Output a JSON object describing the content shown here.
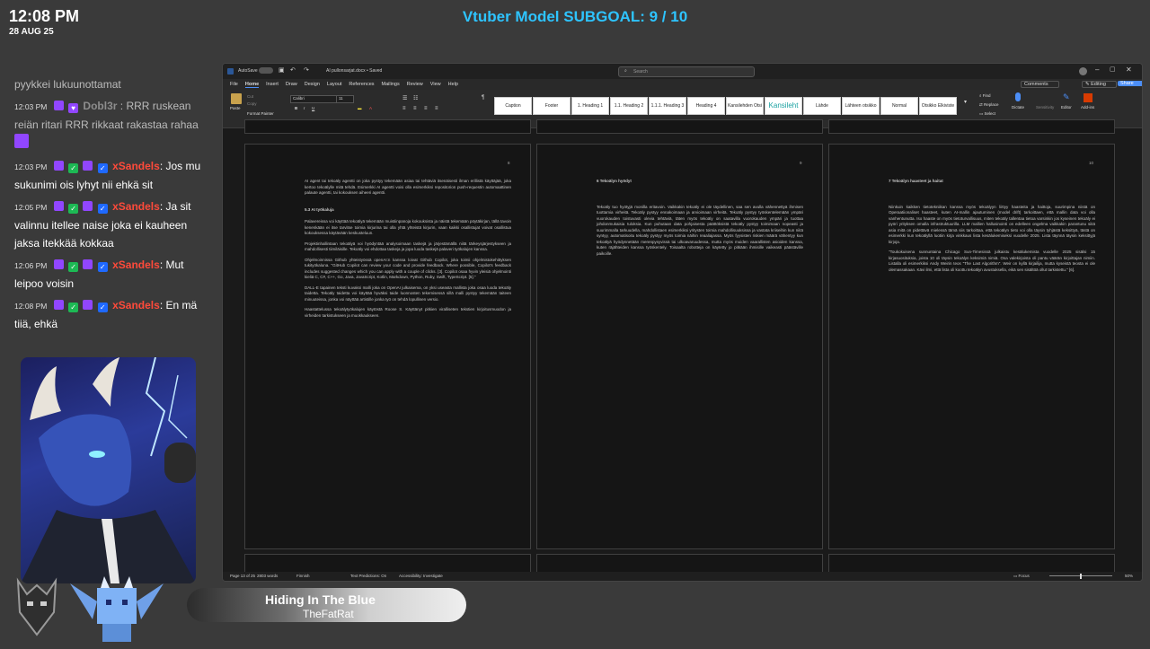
{
  "overlay": {
    "time": "12:08 PM",
    "date": "28 AUG 25",
    "subgoal": "Vtuber Model SUBGOAL: 9 / 10"
  },
  "chat": [
    {
      "time": "",
      "user": "",
      "text": "pyykkei lukuunottamat"
    },
    {
      "time": "12:03 PM",
      "user": "Dobl3r",
      "text": ": RRR ruskean reiän ritari RRR rikkaat rakastaa rahaa"
    },
    {
      "time": "12:03 PM",
      "user": "xSandels",
      "text": ": Jos mu sukunimi ois lyhyt nii ehkä sit"
    },
    {
      "time": "12:05 PM",
      "user": "xSandels",
      "text": ": Ja sit valinnu itellee naise joka ei kauheen jaksa itekkää kokkaa"
    },
    {
      "time": "12:06 PM",
      "user": "xSandels",
      "text": ": Mut leipoo voisin"
    },
    {
      "time": "12:08 PM",
      "user": "xSandels",
      "text": ": En mä tiiä, ehkä"
    }
  ],
  "music": {
    "title": "Hiding In The Blue",
    "artist": "TheFatRat"
  },
  "word": {
    "autosave": "AutoSave",
    "doc_title": "AI pullonsarjat.docx • Saved",
    "search_placeholder": "Search",
    "menu": [
      "File",
      "Home",
      "Insert",
      "Draw",
      "Design",
      "Layout",
      "References",
      "Mailings",
      "Review",
      "View",
      "Help"
    ],
    "comments": "Comments",
    "editing": "Editing",
    "share": "Share",
    "paste": "Paste",
    "cut": "Cut",
    "copy": "Copy",
    "format_painter": "Format Painter",
    "font": "Calibri",
    "font_size": "11",
    "group_clipboard": "Clipboard",
    "group_font": "Font",
    "group_paragraph": "Paragraph",
    "group_styles": "Styles",
    "group_editing": "Editing",
    "group_voice": "Voice",
    "group_sensitivity": "Sensitivity",
    "group_editor": "Editor",
    "group_addins": "Add-ins",
    "styles": [
      "Caption",
      "Footer",
      "1. Heading 1",
      "1.1. Heading 2",
      "1.1.1. Heading 3",
      "Heading 4",
      "Kansilehden Otsi",
      "Kansileht",
      "Lähde",
      "Lähteen otsikko",
      "Normal",
      "Otsikko Elkiviste"
    ],
    "find": "Find",
    "replace": "Replace",
    "select": "Select",
    "dictate": "Dictate",
    "sensitivity": "Sensitivity",
    "editor": "Editor",
    "addins": "Add-ins",
    "status": {
      "page": "Page 13 of 25",
      "words": "2803 words",
      "lang": "Finnish",
      "predictions": "Text Predictions: On",
      "accessibility": "Accessibility: Investigate",
      "focus": "Focus",
      "zoom": "50%"
    },
    "pages": [
      {
        "num": "8",
        "paragraphs": [
          "AI agent tai tekoäly agentti on joka pystyy tekemään asiaa tai tehtäviä itsenäisesti ilman erillistä käyttäjää, joka kertoo tekoälylle mitä tehdä. Esimerkki AI agentti voisi olla esimerkiksi repositorion push-requestin automaattinen palaute agentti, tai kokouksen aiheeri agentti.",
          "5.3      AI työkaluja",
          "Palavereissa voi käyttää tekoälyä tekemään muistiinpanoja kokouksista ja näistä tekemään pöytäkirjan, tällä tavoin kenenkään ei itse tarvitse toimia kirjurina tai olla yhtä yhteistä kirjurin, vaan kaikki osallistujat voivat osallistua kokouksessa käytävään keskusteluun.",
          "Projektinhallintaan tekoälyä voi hyödyntää analysoimaan taskejä ja järjestämällä niitä tärkeysjärjestykseen ja mahdollisesti tiimiläisille. Tekoäly voi ehdottaa taskeja ja jopa luoda taskejä palaveri työkalujen kanssa.",
          "Ohjelmoinnissa Github yhteistyössä openAI:n kanssa loivat Github Copilot, joka toimii ohjelmistokehittyksen tukityökaluna. \"GitHub Copilot can review your code and provide feedback. Where possible, Copilot's feedback includes suggested changes which you can apply with a couple of clicks. [3]. Copilot osaa hyvin yleisiä ohjelmointi kieliä C, C#, C++, Go, Java, JavaScript, Kotlin, Markdown, Python, Ruby, Swift, TypeScript. [5].\"",
          "DALL-E tapainen teksti kuvaksi malli joka on OpenAI julkaisema, on yksi useasta mallista joka osaa luoda tekoäly taidetta. Tekoäly taidetta voi käyttää hyväksi taide luonnosten tekemisessä sillä malli pystyy tekemään taiteen minuuteissa, jonka voi näyttää artistille jonka työ on tehdä lopullinen versio.",
          "Haastattelussa tekoälytyökalujen käytöstä Roose S. Käyttänyt pitkien viralliseten tekstien kirjoitusmuodon ja virheiden tarkistukseen ja muokkaukseen."
        ]
      },
      {
        "num": "9",
        "paragraphs": [
          "6       Tekoälyn hyödyt",
          "Tekoäly tuo hyötyjä monilla eritavoin. Vaikkakin tekoäly ei ole täydellinen, saa sen avulla vähennettyä ihmisen tuottamia virheitä. Tekoäly pystyy ennakoimaan ja arvioimaan virheitä. Tekoäly pystyy työskentelemään ympäri vuorokauden toistuvasti olevia tehtäviä, täten myös tekoäly on saatavilla vuorokauden ympäri ja tuottaa johdonmukaisia tuloksia. Kun puhutaan data pohjaisesta päättöksistä tekoäly pystyy toimimaan nopeasti ja suurimmalla tarkuudella, mahdollistaen esimerkiksi yritysten toimia mahdollisuuksissa ja vastata kriiseihin kun niitä syntyy, automatisoitu tekoäly pystyy myös toimia näihin reaaliajassa. Myös fyysisten riskien määrä vähentyy kun tekoälyä hyödynnetään merenpysyvissä tai ulkoavaruudessa, mutta myös muiden vaarallisten asioiden kanssa, kuten räjähteiden kanssa työskentely. Toisaalta robotteja on käytetty jo pitkään ihmisille vaikeasti päästäville paikoille."
        ]
      },
      {
        "num": "10",
        "paragraphs": [
          "7       Tekoälyn haasteet ja haitat",
          "Niinkuin kaikken tietotekniikan kanssa myös tekoälyyn liittyy haasteita ja haittoja, suurimpina niistä on Operaatiionaliset haasteet, kuten AI-mallin ajautuminen (model drift) tarkoittaen, että mallin data voi olla vanhentunutta. Iso haaste on myös tietoturvallisuus, miten tekoäly tallentaa tietoa varsinkin jos kyseinen tekoäly ei pyöri yrityksen omalla infrastruktuurilla. LLM mallien hallusinointi on edelleen ongelma vaikkakin parantunu siitä asia mitä on pidettävä mielessä tämä siis tarkoittaa, että tekoälyn tieto voi olla täysin tyhjästä keksittyä, tästä on esimerkki kun tekoälyllä luotiin kirja vinkkaus lista kesälukemiseksi vuodelle 2025. Lista täynnä täysin keksittyjä kirjoja.",
          "\"Toukokuisena sunnuntaina Chicago Sun-Timesissä julkaistu kesälukemista vuodelle 2025 sisälsi 15 kirjasuosituksia, joista 10 oli täysin tekoälyn keksimiä nimiä. Osa valekirjoista oli pantu väärän kirjoittajan nimiin. Listalla oli esimerkiksi Andy Weirin teos \"The Last Algorithm\". Weir on kyllä kirjailija, mutta kyseistä teosta ei ole olemassakaan. Kävi ilmi, että lista oli koottu tekoälyn avustuksella, eikä sen sisältöä ollut tarkistettu.\" [6]."
        ]
      }
    ]
  }
}
